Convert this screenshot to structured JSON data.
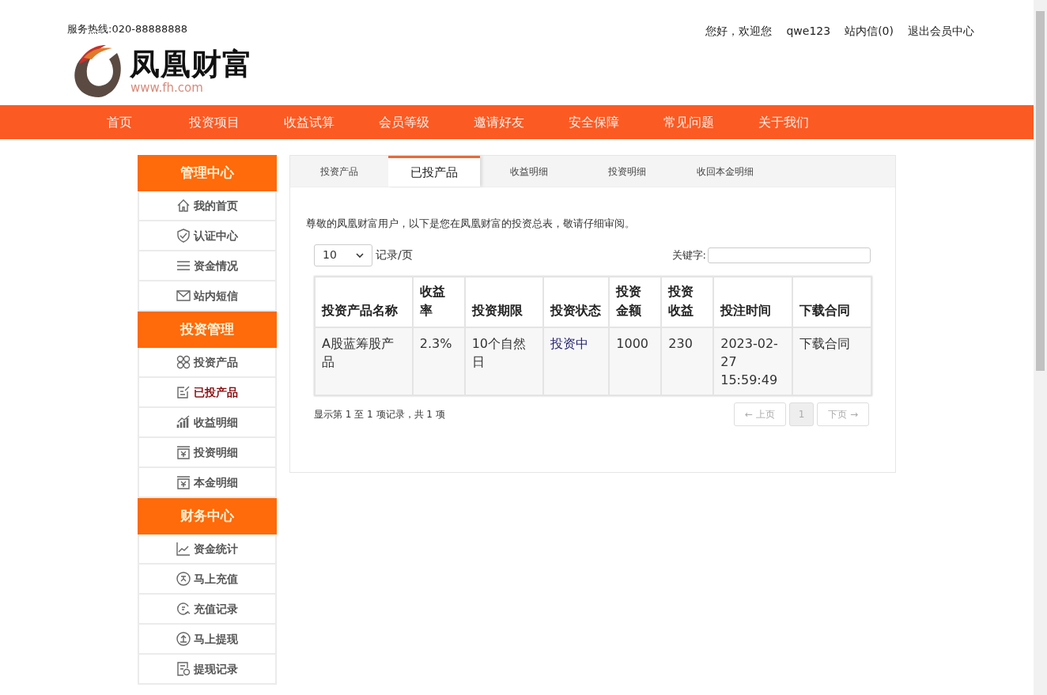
{
  "header": {
    "hotline": "服务热线:020-88888888",
    "logo": {
      "name": "凤凰财富",
      "url": "www.fh.com"
    },
    "user_links": [
      "您好，欢迎您",
      "qwe123",
      "站内信(0)",
      "退出会员中心"
    ]
  },
  "nav": [
    {
      "label": "首页"
    },
    {
      "label": "投资项目"
    },
    {
      "label": "收益试算"
    },
    {
      "label": "会员等级"
    },
    {
      "label": "邀请好友"
    },
    {
      "label": "安全保障"
    },
    {
      "label": "常见问题"
    },
    {
      "label": "关于我们"
    }
  ],
  "sidebar": [
    {
      "title": "管理中心",
      "items": [
        {
          "label": "我的首页",
          "selected": false
        },
        {
          "label": "认证中心",
          "selected": false
        },
        {
          "label": "资金情况",
          "selected": false
        },
        {
          "label": "站内短信",
          "selected": false
        }
      ]
    },
    {
      "title": "投资管理",
      "items": [
        {
          "label": "投资产品",
          "selected": false
        },
        {
          "label": "已投产品",
          "selected": true
        },
        {
          "label": "收益明细",
          "selected": false
        },
        {
          "label": "投资明细",
          "selected": false
        },
        {
          "label": "本金明细",
          "selected": false
        }
      ]
    },
    {
      "title": "财务中心",
      "items": [
        {
          "label": "资金统计",
          "selected": false
        },
        {
          "label": "马上充值",
          "selected": false
        },
        {
          "label": "充值记录",
          "selected": false
        },
        {
          "label": "马上提现",
          "selected": false
        },
        {
          "label": "提现记录",
          "selected": false
        }
      ]
    }
  ],
  "tabs": [
    {
      "label": "投资产品",
      "selected": false
    },
    {
      "label": "已投产品",
      "selected": true
    },
    {
      "label": "收益明细",
      "selected": false
    },
    {
      "label": "投资明细",
      "selected": false
    },
    {
      "label": "收回本金明细",
      "selected": false
    }
  ],
  "intro": "尊敬的凤凰财富用户，以下是您在凤凰财富的投资总表，敬请仔细审阅。",
  "page_size": {
    "value": "10",
    "suffix": "记录/页"
  },
  "search": {
    "label": "关键字:"
  },
  "table": {
    "columns": [
      "投资产品名称",
      "收益率",
      "投资期限",
      "投资状态",
      "投资金额",
      "投资收益",
      "投注时间",
      "下载合同"
    ],
    "rows": [
      [
        "A股蓝筹股产品",
        "2.3%",
        "10个自然日",
        "投资中",
        "1000",
        "230",
        "2023-02-27 15:59:49",
        "下载合同"
      ]
    ]
  },
  "summary": "显示第 1 至 1 项记录，共 1 项",
  "pagination": [
    {
      "label": "← 上页",
      "kind": "nav",
      "selected": false
    },
    {
      "label": "1",
      "kind": "page",
      "selected": true
    },
    {
      "label": "下页 →",
      "kind": "nav",
      "selected": false
    }
  ]
}
